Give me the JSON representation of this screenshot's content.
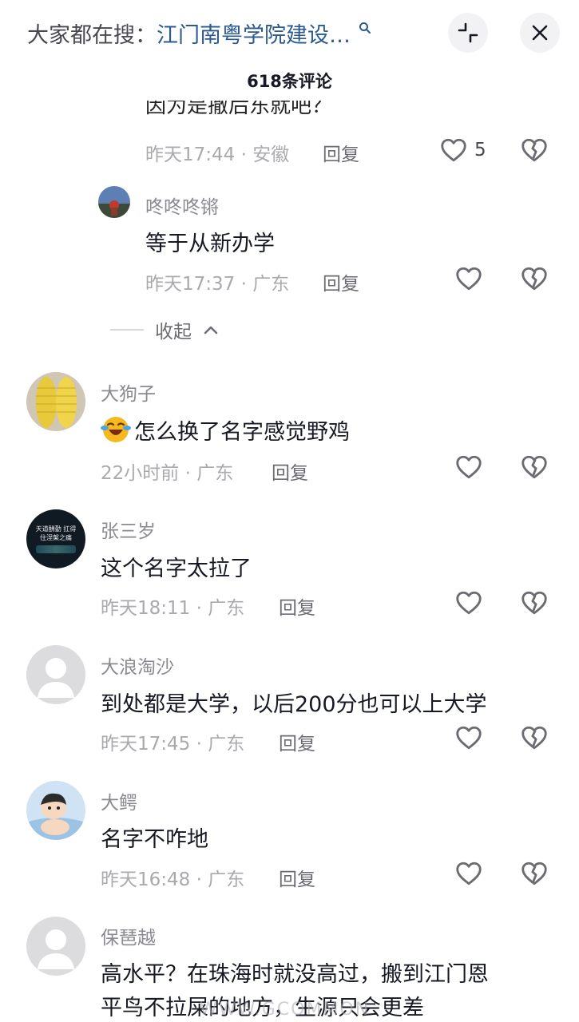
{
  "header": {
    "search_prefix": "大家都在搜：",
    "search_topic": "江门南粤学院建设…",
    "comment_count_title": "618条评论"
  },
  "icons": {
    "search": "search-icon",
    "minimize": "minimize-icon",
    "close": "close-icon",
    "like": "heart-icon",
    "dislike": "broken-heart-icon",
    "collapse": "chevron-up-icon"
  },
  "comments": [
    {
      "text": "因为是撤后东就吧？",
      "meta": "昨天17:44 · 安徽",
      "reply": "回复",
      "likes": "5"
    },
    {
      "name": "咚咚咚锵",
      "text": "等于从新办学",
      "meta": "昨天17:37 · 广东",
      "reply": "回复"
    },
    {
      "name": "大狗子",
      "text": "怎么换了名字感觉野鸡",
      "meta": "22小时前 · 广东",
      "reply": "回复"
    },
    {
      "name": "张三岁",
      "avatar_text": "天道酬勤 扛得住涅槃之痛",
      "text": "这个名字太拉了",
      "meta": "昨天18:11 · 广东",
      "reply": "回复"
    },
    {
      "name": "大浪淘沙",
      "text": "到处都是大学，以后200分也可以上大学",
      "meta": "昨天17:45 · 广东",
      "reply": "回复"
    },
    {
      "name": "大鳄",
      "text": "名字不咋地",
      "meta": "昨天16:48 · 广东",
      "reply": "回复"
    },
    {
      "name": "保琶越",
      "text_line1": "高水平？在珠海时就没高过，搬到江门恩",
      "text_line2": "平鸟不拉屎的地方，生源只会更差"
    }
  ],
  "collapse_label": "收起",
  "watermark": "WWW.GCOMMON"
}
